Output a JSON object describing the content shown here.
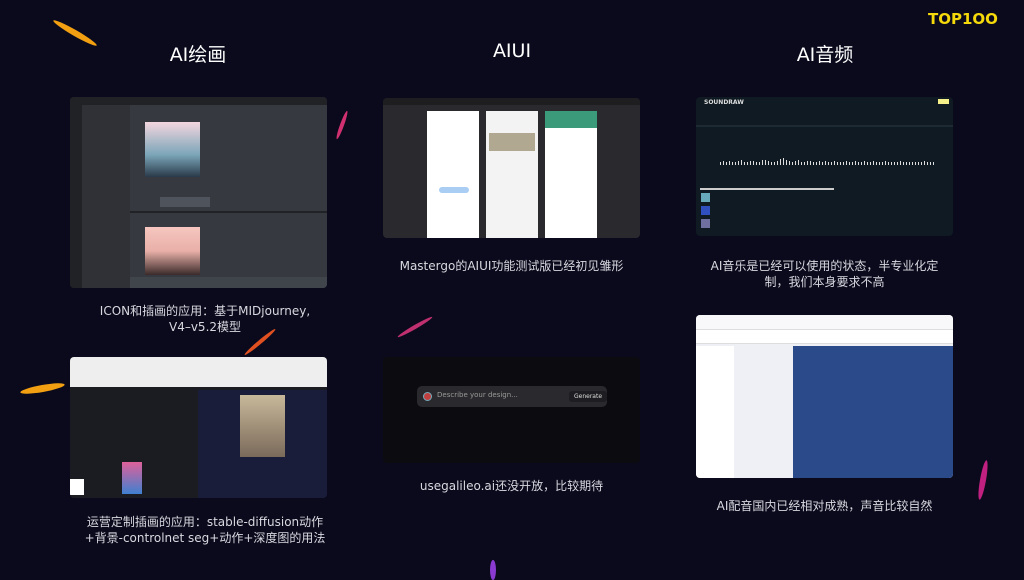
{
  "logo": "TOP1OO",
  "columns": [
    {
      "title": "AI绘画"
    },
    {
      "title": "AIUI"
    },
    {
      "title": "AI音频"
    }
  ],
  "captions": {
    "midjourney": [
      "ICON和插画的应用：基于MIDjourney,",
      "V4–v5.2模型"
    ],
    "stable_diffusion": [
      "运营定制插画的应用：stable-diffusion动作",
      "+背景-controlnet seg+动作+深度图的用法"
    ],
    "mastergo": "Mastergo的AIUI功能测试版已经初见雏形",
    "galileo": "usegalileo.ai还没开放，比较期待",
    "soundraw": [
      "AI音乐是已经可以使用的状态，半专业化定",
      "制，我们本身要求不高"
    ],
    "voice": "AI配音国内已经相对成熟，声音比较自然"
  },
  "galileo": {
    "placeholder": "Describe your design...",
    "generate": "Generate"
  },
  "soundraw": {
    "brand": "SOUNDRAW"
  },
  "colors": {
    "bg": "#0a0a1c",
    "logo": "#f5d90a",
    "accent_voice": "#2a4a8a"
  }
}
